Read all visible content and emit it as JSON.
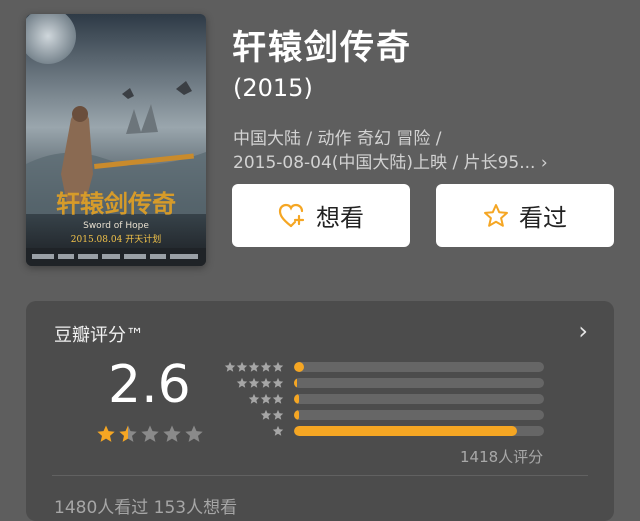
{
  "movie": {
    "title": "轩辕剑传奇",
    "year": "(2015)",
    "meta_line1": "中国大陆 / 动作 奇幻 冒险 /",
    "meta_line2": "2015-08-04(中国大陆)上映 / 片长95... ›",
    "poster": {
      "title_art": "轩辕剑传奇",
      "english_title": "Sword of Hope",
      "date_text": "2015.08.04  开天计划",
      "icon": "movie-poster-image"
    }
  },
  "actions": {
    "want_label": "想看",
    "want_icon": "heart-plus-icon",
    "seen_label": "看过",
    "seen_icon": "star-outline-icon"
  },
  "rating": {
    "label": "豆瓣评分™",
    "score": "2.6",
    "stars_filled": 1.5,
    "stars_total": 5,
    "distribution": [
      {
        "stars": 5,
        "percent": 4
      },
      {
        "stars": 4,
        "percent": 1
      },
      {
        "stars": 3,
        "percent": 2
      },
      {
        "stars": 2,
        "percent": 2
      },
      {
        "stars": 1,
        "percent": 89
      }
    ],
    "count_text": "1418人评分",
    "chevron_icon": "chevron-right-icon",
    "colors": {
      "accent": "#f5a623",
      "track": "#666666",
      "inactive_star": "#8a8a8a"
    }
  },
  "stats": {
    "text": "1480人看过   153人想看"
  }
}
